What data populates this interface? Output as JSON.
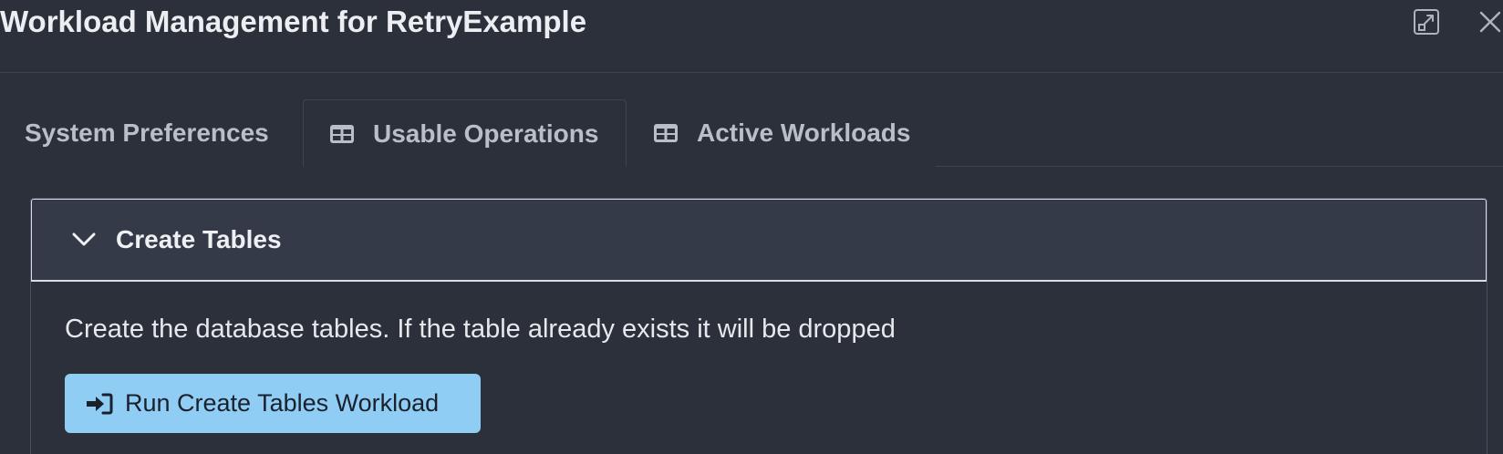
{
  "window": {
    "title": "Workload Management for RetryExample",
    "expand_icon": "expand-icon",
    "close_icon": "close-icon"
  },
  "tabs": [
    {
      "label": "System Preferences",
      "icon": ""
    },
    {
      "label": "Usable Operations",
      "icon": "table-icon",
      "selected": true
    },
    {
      "label": "Active Workloads",
      "icon": "table-icon"
    }
  ],
  "accordion": {
    "title": "Create Tables",
    "expanded": true,
    "chevron_icon": "chevron-down-icon",
    "description": "Create the database tables. If the table already exists it will be dropped",
    "run_button": {
      "label": "Run Create Tables Workload",
      "icon": "sign-in-icon"
    }
  },
  "colors": {
    "background": "#2b303b",
    "accordion_header_bg": "#343a47",
    "accent_button": "#90cdf4",
    "text": "#e8eaee",
    "muted_text": "#b9bec8"
  }
}
